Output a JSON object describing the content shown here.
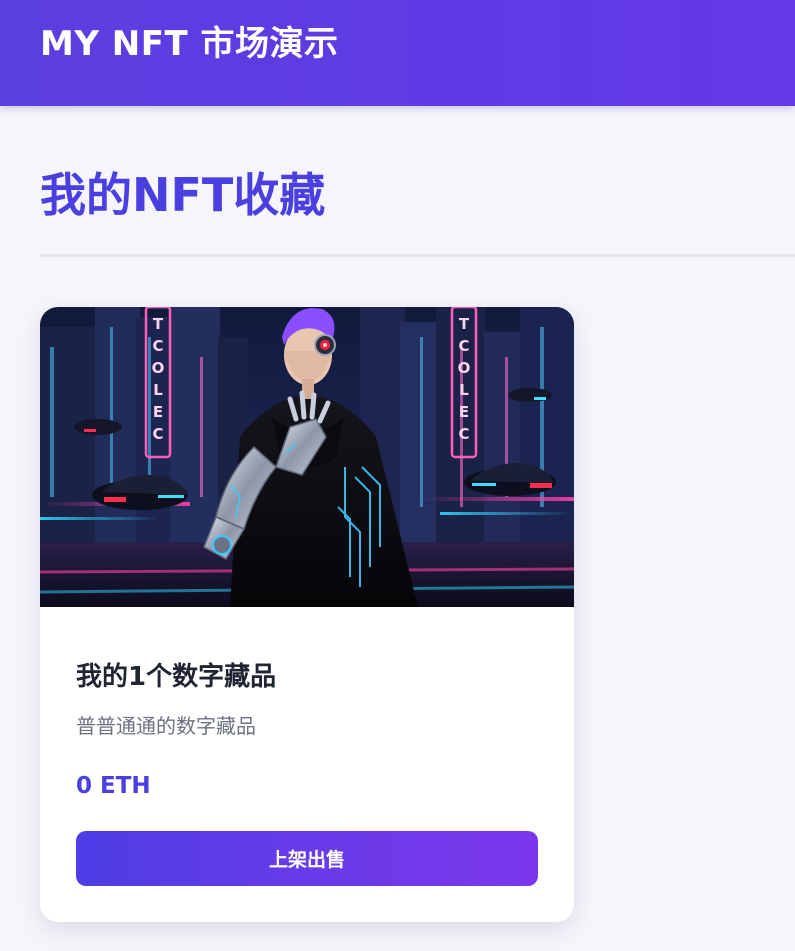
{
  "header": {
    "brand": "MY NFT 市场演示"
  },
  "main": {
    "title": "我的NFT收藏",
    "cards": [
      {
        "image_alt": "cyberpunk android with robotic arm on neon city street",
        "title": "我的1个数字藏品",
        "description": "普普通通的数字藏品",
        "price": "0 ETH",
        "action_label": "上架出售",
        "neon_sign_text": "NFT COLECT"
      }
    ]
  },
  "colors": {
    "header_bg": "#5b3fe0",
    "accent": "#4a3fe0",
    "button_start": "#4d3de6",
    "button_end": "#7a36ea",
    "page_bg": "#f5f5fb",
    "card_bg": "#ffffff"
  }
}
